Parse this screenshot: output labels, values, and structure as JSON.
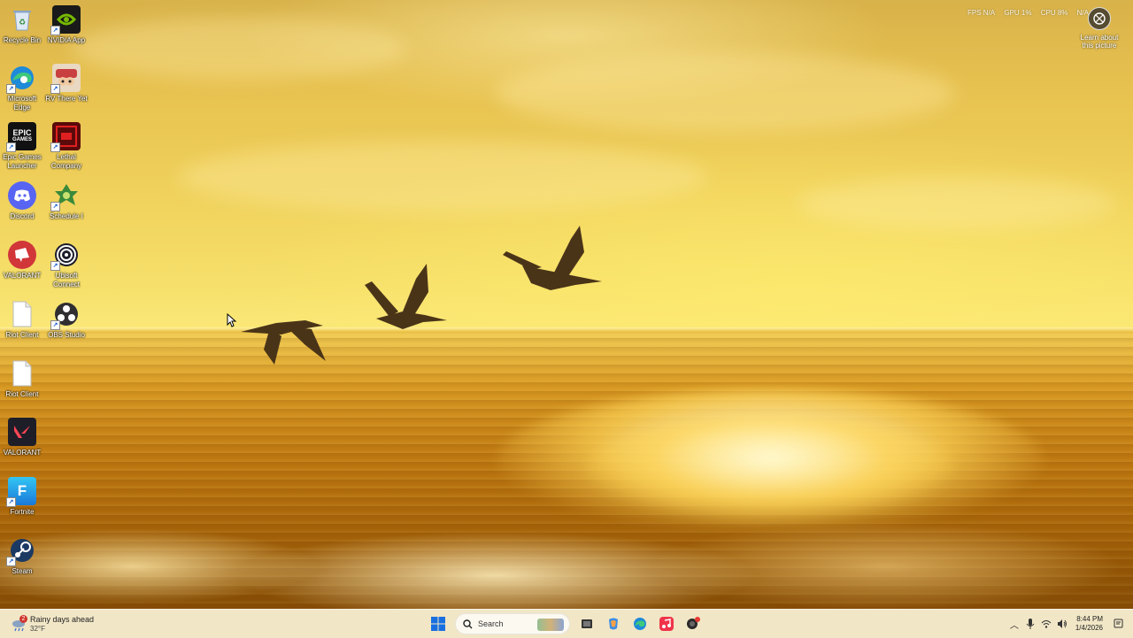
{
  "desktop": {
    "icons": [
      {
        "label": "Recycle Bin",
        "icon": "recycle-bin-icon"
      },
      {
        "label": "NVIDIA App",
        "icon": "nvidia-icon"
      },
      {
        "label": "Microsoft Edge",
        "icon": "edge-icon"
      },
      {
        "label": "RV There Yet",
        "icon": "rv-there-yet-icon"
      },
      {
        "label": "Epic Games Launcher",
        "icon": "epic-games-icon"
      },
      {
        "label": "Lethal Company",
        "icon": "lethal-company-icon"
      },
      {
        "label": "Discord",
        "icon": "discord-icon"
      },
      {
        "label": "Schedule I",
        "icon": "schedule-one-icon"
      },
      {
        "label": "VALORANT",
        "icon": "riot-icon"
      },
      {
        "label": "Ubisoft Connect",
        "icon": "ubisoft-icon"
      },
      {
        "label": "Riot Client",
        "icon": "file-icon"
      },
      {
        "label": "OBS Studio",
        "icon": "obs-icon"
      },
      {
        "label": "Riot Client",
        "icon": "file-icon"
      },
      {
        "label": "VALORANT",
        "icon": "valorant-icon"
      },
      {
        "label": "Fortnite",
        "icon": "fortnite-icon"
      },
      {
        "label": "Steam",
        "icon": "steam-icon"
      }
    ]
  },
  "overlay": {
    "fps": "FPS N/A",
    "gpu": "GPU 1%",
    "cpu": "CPU 8%",
    "extra": "N/A",
    "learn_label": "Learn about this picture"
  },
  "taskbar": {
    "weather_line1": "Rainy days ahead",
    "weather_line2": "32°F",
    "weather_badge": "2",
    "search_placeholder": "Search",
    "time": "8:44 PM",
    "date": "1/4/2026"
  },
  "colors": {
    "taskbar_bg": "#f3ecd5",
    "sky": "#efd05a",
    "sea": "#c07a12"
  }
}
